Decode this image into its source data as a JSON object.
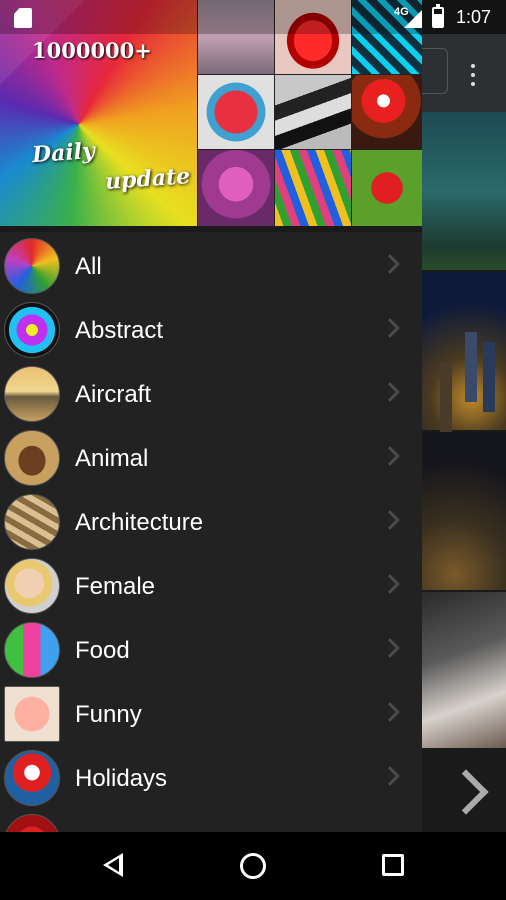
{
  "status_bar": {
    "network": "4G",
    "time": "1:07"
  },
  "drawer": {
    "header": {
      "count_text": "1000000+",
      "tagline_1": "Daily",
      "tagline_2": "update"
    },
    "categories": [
      {
        "label": "All",
        "icon": "all-thumbnail"
      },
      {
        "label": "Abstract",
        "icon": "abstract-thumbnail"
      },
      {
        "label": "Aircraft",
        "icon": "aircraft-thumbnail"
      },
      {
        "label": "Animal",
        "icon": "animal-thumbnail"
      },
      {
        "label": "Architecture",
        "icon": "architecture-thumbnail"
      },
      {
        "label": "Female",
        "icon": "female-thumbnail"
      },
      {
        "label": "Food",
        "icon": "food-thumbnail"
      },
      {
        "label": "Funny",
        "icon": "funny-thumbnail"
      },
      {
        "label": "Holidays",
        "icon": "holidays-thumbnail"
      }
    ]
  },
  "nav_bar": {
    "buttons": [
      "back",
      "home",
      "recents"
    ]
  }
}
